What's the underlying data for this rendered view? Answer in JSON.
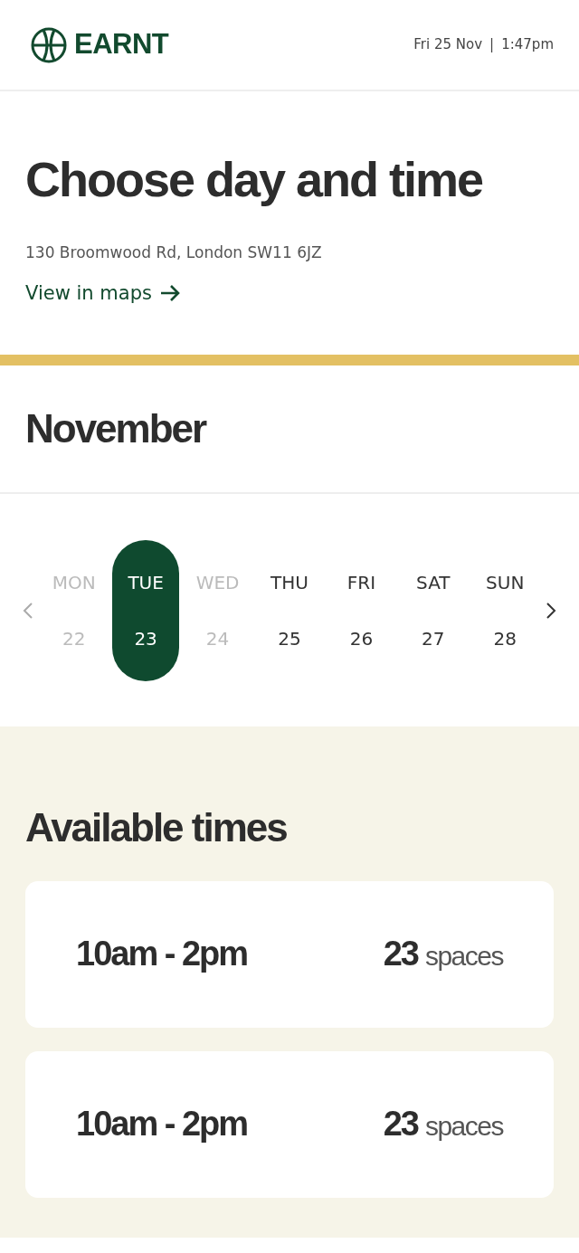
{
  "header": {
    "brand": "EARNT",
    "date": "Fri 25 Nov",
    "separator": "|",
    "time": "1:47pm"
  },
  "intro": {
    "title": "Choose day and time",
    "address": "130 Broomwood Rd, London SW11 6JZ",
    "map_link": "View in maps"
  },
  "calendar": {
    "month": "November",
    "days": [
      {
        "weekday": "MON",
        "date": "22",
        "disabled": true,
        "selected": false
      },
      {
        "weekday": "TUE",
        "date": "23",
        "disabled": false,
        "selected": true
      },
      {
        "weekday": "WED",
        "date": "24",
        "disabled": true,
        "selected": false
      },
      {
        "weekday": "THU",
        "date": "25",
        "disabled": false,
        "selected": false
      },
      {
        "weekday": "FRI",
        "date": "26",
        "disabled": false,
        "selected": false
      },
      {
        "weekday": "SAT",
        "date": "27",
        "disabled": false,
        "selected": false
      },
      {
        "weekday": "SUN",
        "date": "28",
        "disabled": false,
        "selected": false
      }
    ]
  },
  "available": {
    "title": "Available times",
    "slots": [
      {
        "time": "10am - 2pm",
        "count": "23",
        "unit": "spaces"
      },
      {
        "time": "10am - 2pm",
        "count": "23",
        "unit": "spaces"
      }
    ]
  }
}
